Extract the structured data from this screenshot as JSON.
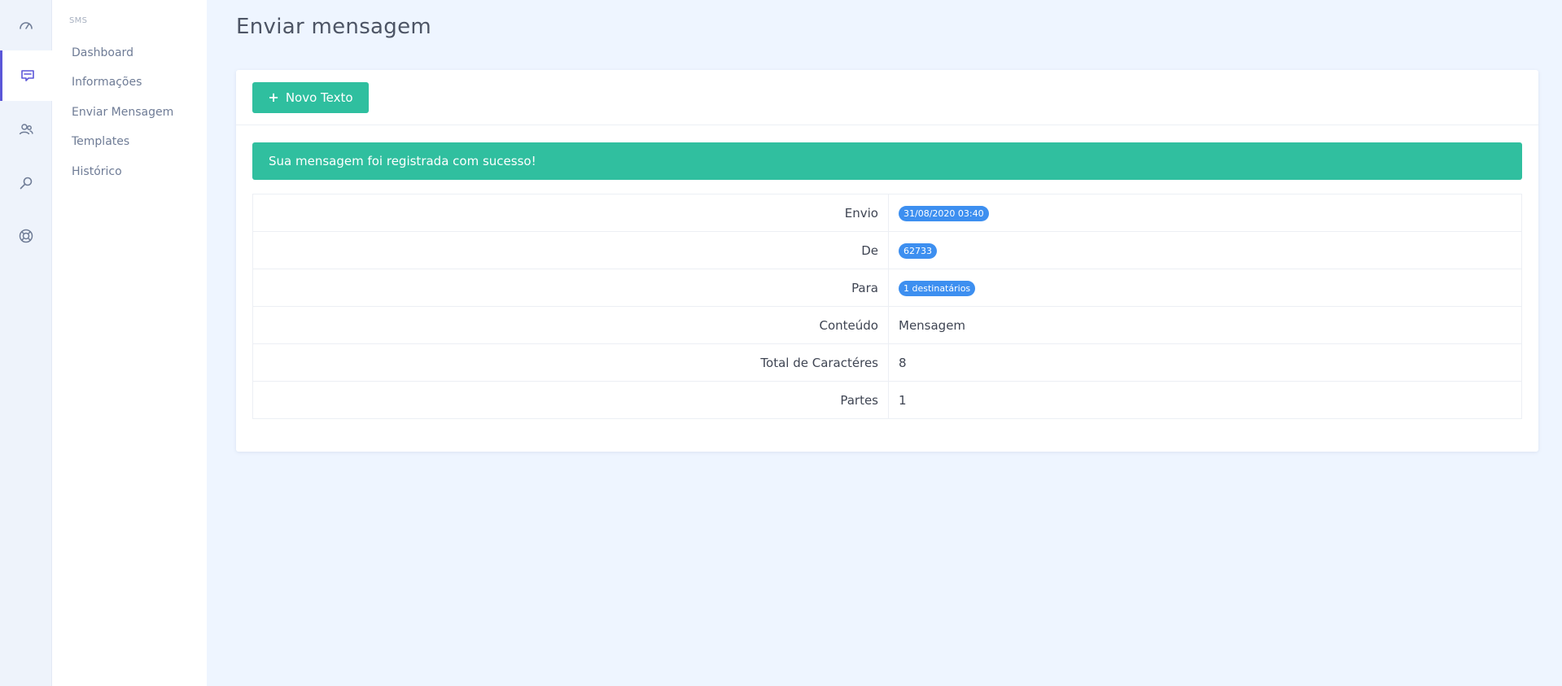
{
  "rail": {
    "items": [
      {
        "icon": "speedometer-icon"
      },
      {
        "icon": "message-icon",
        "active": true
      },
      {
        "icon": "users-icon"
      },
      {
        "icon": "search-icon"
      },
      {
        "icon": "lifebuoy-icon"
      }
    ]
  },
  "submenu": {
    "header": "SMS",
    "items": [
      {
        "label": "Dashboard"
      },
      {
        "label": "Informações"
      },
      {
        "label": "Enviar Mensagem"
      },
      {
        "label": "Templates"
      },
      {
        "label": "Histórico"
      }
    ]
  },
  "page": {
    "title": "Enviar mensagem"
  },
  "toolbar": {
    "new_button_icon": "+",
    "new_button_label": "Novo Texto"
  },
  "alert": {
    "message": "Sua mensagem foi registrada com sucesso!"
  },
  "details": {
    "rows": [
      {
        "label": "Envio",
        "value": "31/08/2020 03:40",
        "badge": true
      },
      {
        "label": "De",
        "value": "62733",
        "badge": true
      },
      {
        "label": "Para",
        "value": "1 destinatários",
        "badge": true
      },
      {
        "label": "Conteúdo",
        "value": "Mensagem",
        "badge": false
      },
      {
        "label": "Total de Caractéres",
        "value": "8",
        "badge": false
      },
      {
        "label": "Partes",
        "value": "1",
        "badge": false
      }
    ]
  },
  "colors": {
    "accent_green": "#2fbf9f",
    "badge_blue": "#3d8ff0",
    "active_indicator": "#5b57d8",
    "background": "#eef5ff"
  }
}
